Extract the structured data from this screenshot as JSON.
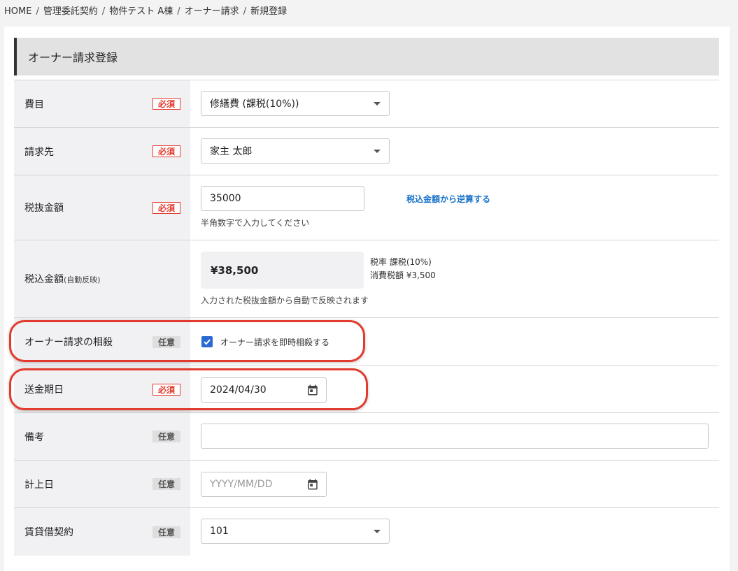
{
  "breadcrumb": [
    "HOME",
    "管理委託契約",
    "物件テスト A棟",
    "オーナー請求",
    "新規登録"
  ],
  "panel": {
    "title": "オーナー請求登録"
  },
  "badges": {
    "required": "必須",
    "optional": "任意"
  },
  "fields": {
    "expense": {
      "label": "費目",
      "value": "修繕費 (課税(10%))"
    },
    "billing_to": {
      "label": "請求先",
      "value": "家主 太郎"
    },
    "amount_ex_tax": {
      "label": "税抜金額",
      "value": "35000",
      "hint": "半角数字で入力してください",
      "link": "税込金額から逆算する"
    },
    "amount_inc_tax": {
      "label": "税込金額",
      "label_suffix": "(自動反映)",
      "value": "¥38,500",
      "tax_rate": "税率 課税(10%)",
      "consumption_tax": "消費税額 ¥3,500",
      "hint": "入力された税抜金額から自動で反映されます"
    },
    "offset": {
      "label": "オーナー請求の相殺",
      "checkbox_label": "オーナー請求を即時相殺する",
      "checked": true
    },
    "remit_date": {
      "label": "送金期日",
      "value": "2024/04/30"
    },
    "remarks": {
      "label": "備考",
      "value": ""
    },
    "posting_date": {
      "label": "計上日",
      "placeholder": "YYYY/MM/DD"
    },
    "lease_contract": {
      "label": "賃貸借契約",
      "value": "101"
    }
  },
  "colors": {
    "required": "#e23b2e",
    "accent": "#2a6ad0",
    "link": "#1a73c8",
    "highlight": "#e23b2e"
  },
  "icons": {
    "dropdown": "chevron-down-icon",
    "calendar": "calendar-icon",
    "checkbox": "check-icon"
  }
}
